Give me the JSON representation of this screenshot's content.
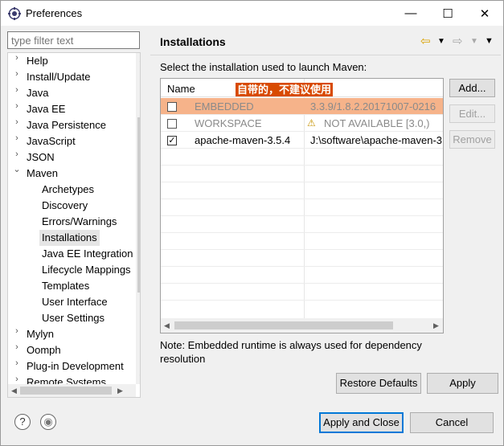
{
  "window": {
    "title": "Preferences",
    "minimize": "—",
    "maximize": "☐",
    "close": "✕"
  },
  "filter": {
    "placeholder": "type filter text"
  },
  "tree": {
    "items": [
      {
        "label": "Help",
        "arrow": "›"
      },
      {
        "label": "Install/Update",
        "arrow": "›"
      },
      {
        "label": "Java",
        "arrow": "›"
      },
      {
        "label": "Java EE",
        "arrow": "›"
      },
      {
        "label": "Java Persistence",
        "arrow": "›"
      },
      {
        "label": "JavaScript",
        "arrow": "›"
      },
      {
        "label": "JSON",
        "arrow": "›"
      },
      {
        "label": "Maven",
        "arrow": "⌄"
      },
      {
        "label": "Archetypes"
      },
      {
        "label": "Discovery"
      },
      {
        "label": "Errors/Warnings"
      },
      {
        "label": "Installations"
      },
      {
        "label": "Java EE Integration"
      },
      {
        "label": "Lifecycle Mappings"
      },
      {
        "label": "Templates"
      },
      {
        "label": "User Interface"
      },
      {
        "label": "User Settings"
      },
      {
        "label": "Mylyn",
        "arrow": "›"
      },
      {
        "label": "Oomph",
        "arrow": "›"
      },
      {
        "label": "Plug-in Development",
        "arrow": "›"
      },
      {
        "label": "Remote Systems",
        "arrow": "›"
      }
    ]
  },
  "page": {
    "title": "Installations",
    "description": "Select the installation used to launch Maven:",
    "annotation": "自带的，不建议使用",
    "column_name": "Name",
    "rows": [
      {
        "name": "EMBEDDED",
        "path": "3.3.9/1.8.2.20171007-0216",
        "checked": false,
        "highlighted": true
      },
      {
        "name": "WORKSPACE",
        "path": "NOT AVAILABLE [3.0,)",
        "checked": false,
        "warning": "⚠"
      },
      {
        "name": "apache-maven-3.5.4",
        "path": "J:\\software\\apache-maven-3",
        "checked": true,
        "check": "✓"
      }
    ],
    "buttons": {
      "add": "Add...",
      "edit": "Edit...",
      "remove": "Remove"
    },
    "note": "Note: Embedded runtime is always used for dependency resolution",
    "restore_defaults": "Restore Defaults",
    "apply": "Apply"
  },
  "footer": {
    "apply_close": "Apply and Close",
    "cancel": "Cancel",
    "help": "?",
    "import": "◉"
  },
  "colors": {
    "highlight_row": "#f6b38a",
    "annotation_bg": "#d84a00",
    "default_button_border": "#0078d7"
  }
}
